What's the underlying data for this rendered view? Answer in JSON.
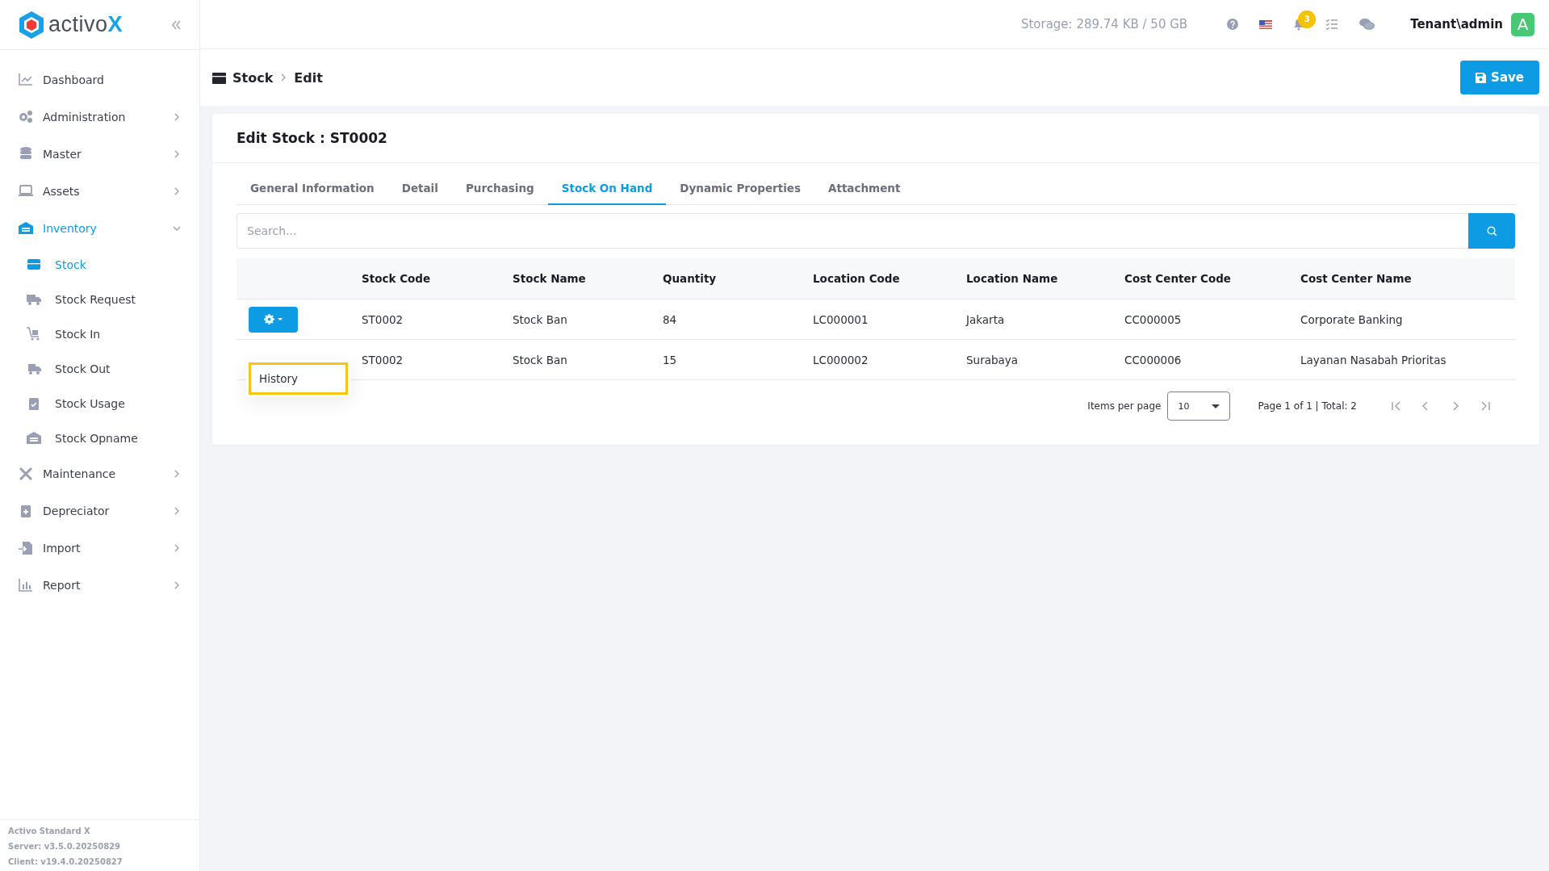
{
  "app": {
    "logo": "activo",
    "logo_accent": "X"
  },
  "sidebar": {
    "items": [
      {
        "label": "Dashboard",
        "kind": "link",
        "selected": false
      },
      {
        "label": "Administration",
        "kind": "group",
        "selected": false,
        "expanded": false
      },
      {
        "label": "Master",
        "kind": "group",
        "selected": false,
        "expanded": false
      },
      {
        "label": "Assets",
        "kind": "group",
        "selected": false,
        "expanded": false
      },
      {
        "label": "Inventory",
        "kind": "group",
        "selected": true,
        "expanded": true,
        "children": [
          {
            "label": "Stock",
            "selected": true
          },
          {
            "label": "Stock Request",
            "selected": false
          },
          {
            "label": "Stock In",
            "selected": false
          },
          {
            "label": "Stock Out",
            "selected": false
          },
          {
            "label": "Stock Usage",
            "selected": false
          },
          {
            "label": "Stock Opname",
            "selected": false
          }
        ]
      },
      {
        "label": "Maintenance",
        "kind": "group",
        "selected": false,
        "expanded": false
      },
      {
        "label": "Depreciator",
        "kind": "group",
        "selected": false,
        "expanded": false
      },
      {
        "label": "Import",
        "kind": "group",
        "selected": false,
        "expanded": false
      },
      {
        "label": "Report",
        "kind": "group",
        "selected": false,
        "expanded": false
      }
    ],
    "footer": [
      "Activo Standard X",
      "Server: v3.5.0.20250829",
      "Client: v19.4.0.20250827"
    ]
  },
  "topbar": {
    "storage": "Storage: 289.74 KB / 50 GB",
    "notification_count": "3",
    "user": "Tenant\\admin",
    "avatar": "A"
  },
  "breadcrumb": [
    "Stock",
    "Edit"
  ],
  "save_button": "Save",
  "card": {
    "title": "Edit Stock : ST0002",
    "tabs": [
      {
        "label": "General Information",
        "selected": false
      },
      {
        "label": "Detail",
        "selected": false
      },
      {
        "label": "Purchasing",
        "selected": false
      },
      {
        "label": "Stock On Hand",
        "selected": true
      },
      {
        "label": "Dynamic Properties",
        "selected": false
      },
      {
        "label": "Attachment",
        "selected": false
      }
    ],
    "search": {
      "placeholder": "Search..."
    },
    "table": {
      "columns": [
        "Stock Code",
        "Stock Name",
        "Quantity",
        "Location Code",
        "Location Name",
        "Cost Center Code",
        "Cost Center Name"
      ],
      "rows": [
        [
          "ST0002",
          "Stock Ban",
          "84",
          "LC000001",
          "Jakarta",
          "CC000005",
          "Corporate Banking"
        ],
        [
          "ST0002",
          "Stock Ban",
          "15",
          "LC000002",
          "Surabaya",
          "CC000006",
          "Layanan Nasabah Prioritas"
        ]
      ]
    },
    "action_menu": {
      "items": [
        {
          "label": "History",
          "focused": true
        }
      ]
    },
    "pagination": {
      "items_per_page_label": "Items per page",
      "items_per_page": "10",
      "page_info": "Page 1 of 1 | Total: 2"
    }
  }
}
